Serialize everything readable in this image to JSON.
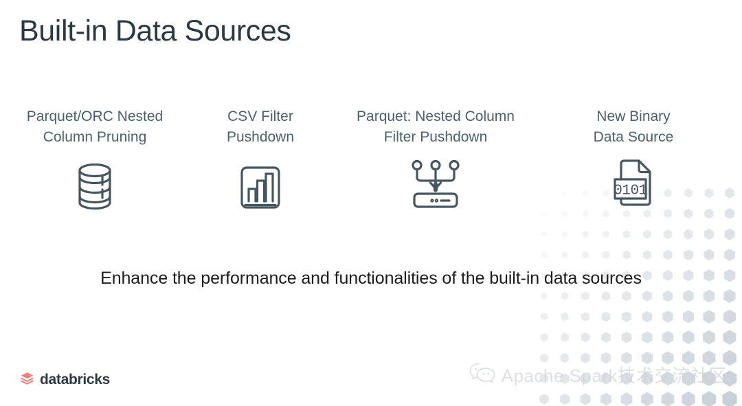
{
  "slide": {
    "title": "Built-in Data Sources",
    "caption": "Enhance the performance and functionalities of the built-in data sources",
    "background_color": "#ffffff",
    "title_color": "#2b3a42",
    "label_color": "#4a616d",
    "icon_color": "#465660",
    "accent_color": "#ff3621",
    "hexagon_color": "#c3ccd4"
  },
  "features": [
    {
      "label": "Parquet/ORC Nested\nColumn Pruning",
      "icon": "database-cylinder-icon"
    },
    {
      "label": "CSV Filter\nPushdown",
      "icon": "bar-chart-icon"
    },
    {
      "label": "Parquet: Nested Column\nFilter Pushdown",
      "icon": "filter-pushdown-circuit-icon"
    },
    {
      "label": "New Binary\nData Source",
      "icon": "binary-file-icon"
    }
  ],
  "brand": {
    "name": "databricks",
    "logo": "databricks-stack-logo",
    "logo_color": "#ef8076"
  },
  "watermark": {
    "text": "Apache Spark技术交流社区",
    "icon": "wechat-icon",
    "color": "#ced5da"
  }
}
